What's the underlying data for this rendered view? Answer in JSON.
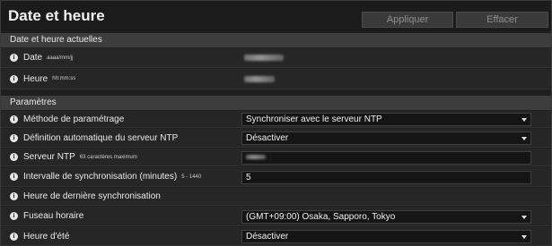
{
  "header": {
    "title": "Date et heure",
    "apply_label": "Appliquer",
    "clear_label": "Effacer"
  },
  "current": {
    "section_title": "Date et heure actuelles",
    "date_label": "Date",
    "date_hint": "aaaa/mm/jj",
    "time_label": "Heure",
    "time_hint": "hh:mm:ss"
  },
  "params": {
    "section_title": "Paramètres",
    "method_label": "Méthode de paramétrage",
    "method_value": "Synchroniser avec le serveur NTP",
    "auto_ntp_label": "Définition automatique du serveur NTP",
    "auto_ntp_value": "Désactiver",
    "ntp_server_label": "Serveur NTP",
    "ntp_server_hint": "63 caractères maximum",
    "interval_label": "Intervalle de synchronisation (minutes)",
    "interval_hint": "5 - 1440",
    "interval_value": "5",
    "last_sync_label": "Heure de dernière synchronisation",
    "timezone_label": "Fuseau horaire",
    "timezone_value": "(GMT+09:00) Osaka, Sapporo, Tokyo",
    "dst_label": "Heure d'été",
    "dst_value": "Désactiver"
  },
  "icons": {
    "info": "info-icon",
    "dropdown": "chevron-down-icon"
  },
  "colors": {
    "background": "#1f1f1f",
    "section_bar": "#3d3d3d",
    "field": "#151515"
  }
}
